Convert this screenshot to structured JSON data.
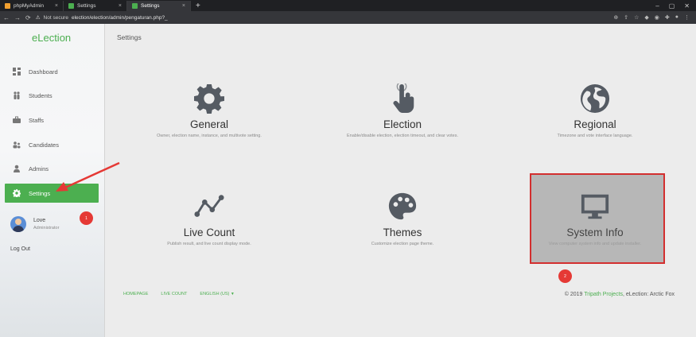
{
  "browser": {
    "tabs": [
      {
        "label": "phpMyAdmin",
        "color": "#f0a030"
      },
      {
        "label": "Settings",
        "color": "#4caf50"
      },
      {
        "label": "Settings",
        "color": "#4caf50"
      }
    ],
    "new_tab": "+",
    "security": "Not secure",
    "url": "election/election/admin/pengaturan.php?_"
  },
  "sidebar": {
    "brand": "eLection",
    "items": [
      {
        "label": "Dashboard",
        "icon": "dashboard-icon"
      },
      {
        "label": "Students",
        "icon": "students-icon"
      },
      {
        "label": "Staffs",
        "icon": "briefcase-icon"
      },
      {
        "label": "Candidates",
        "icon": "candidates-icon"
      },
      {
        "label": "Admins",
        "icon": "user-icon"
      },
      {
        "label": "Settings",
        "icon": "gear-icon"
      }
    ],
    "user": {
      "name": "Love",
      "role": "Administrator"
    },
    "logout": "Log Out"
  },
  "main": {
    "title": "Settings",
    "cards": [
      {
        "title": "General",
        "desc": "Owner, election name, instance, and multivote setting.",
        "icon": "gear-icon"
      },
      {
        "title": "Election",
        "desc": "Enable/disable election, election timeout, and clear votes.",
        "icon": "hand-pointer-icon"
      },
      {
        "title": "Regional",
        "desc": "Timezone and vote interface language.",
        "icon": "globe-icon"
      },
      {
        "title": "Live Count",
        "desc": "Publish result, and live count display mode.",
        "icon": "line-chart-icon"
      },
      {
        "title": "Themes",
        "desc": "Customize election page theme.",
        "icon": "palette-icon"
      },
      {
        "title": "System Info",
        "desc": "View computer system info and update installer.",
        "icon": "monitor-icon"
      }
    ],
    "footer": {
      "links": [
        "HOMEPAGE",
        "LIVE COUNT",
        "ENGLISH (US)"
      ],
      "copyright_pre": "© 2019",
      "copyright_link": "Tripath Projects",
      "copyright_post": ", eLection: Arctic Fox"
    }
  },
  "annotations": {
    "step1": "1",
    "step2": "2",
    "color": "#e53935"
  }
}
